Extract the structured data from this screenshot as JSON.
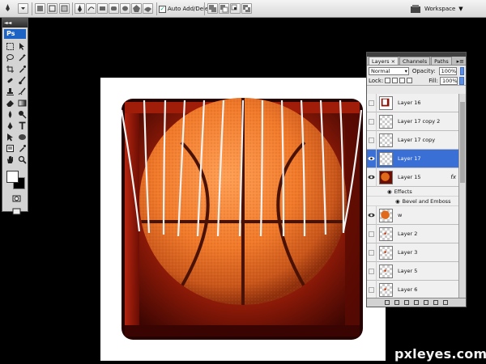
{
  "options_bar": {
    "auto_add_delete_label": "Auto Add/Delete",
    "auto_add_checked": true,
    "workspace_label": "Workspace"
  },
  "tools_panel": {
    "collapse_glyph": "◄◄",
    "logo": "Ps",
    "foreground_color": "#ffffff",
    "background_color": "#000000"
  },
  "layers_panel": {
    "tabs": [
      "Layers",
      "Channels",
      "Paths"
    ],
    "active_tab": "Layers",
    "blend_mode": "Normal",
    "opacity_label": "Opacity:",
    "opacity_value": "100%",
    "lock_label": "Lock:",
    "fill_label": "Fill:",
    "fill_value": "100%",
    "layers": [
      {
        "name": "Layer 16",
        "visible": false,
        "selected": false
      },
      {
        "name": "Layer 17 copy 2",
        "visible": false,
        "selected": false
      },
      {
        "name": "Layer 17 copy",
        "visible": false,
        "selected": false
      },
      {
        "name": "Layer 17",
        "visible": true,
        "selected": true
      },
      {
        "name": "Layer 15",
        "visible": true,
        "selected": false,
        "fx": "fx"
      },
      {
        "name": "w",
        "visible": true,
        "selected": false
      },
      {
        "name": "Layer 2",
        "visible": false,
        "selected": false
      },
      {
        "name": "Layer 3",
        "visible": false,
        "selected": false
      },
      {
        "name": "Layer 5",
        "visible": false,
        "selected": false
      },
      {
        "name": "Layer 6",
        "visible": false,
        "selected": false
      }
    ],
    "effects_label": "Effects",
    "effect_item": "Bevel and Emboss"
  },
  "colors": {
    "ball_orange": "#e06a1a",
    "box_red": "#8a1408",
    "selection_blue": "#3a6fd6"
  },
  "watermark": "pxleyes.com"
}
